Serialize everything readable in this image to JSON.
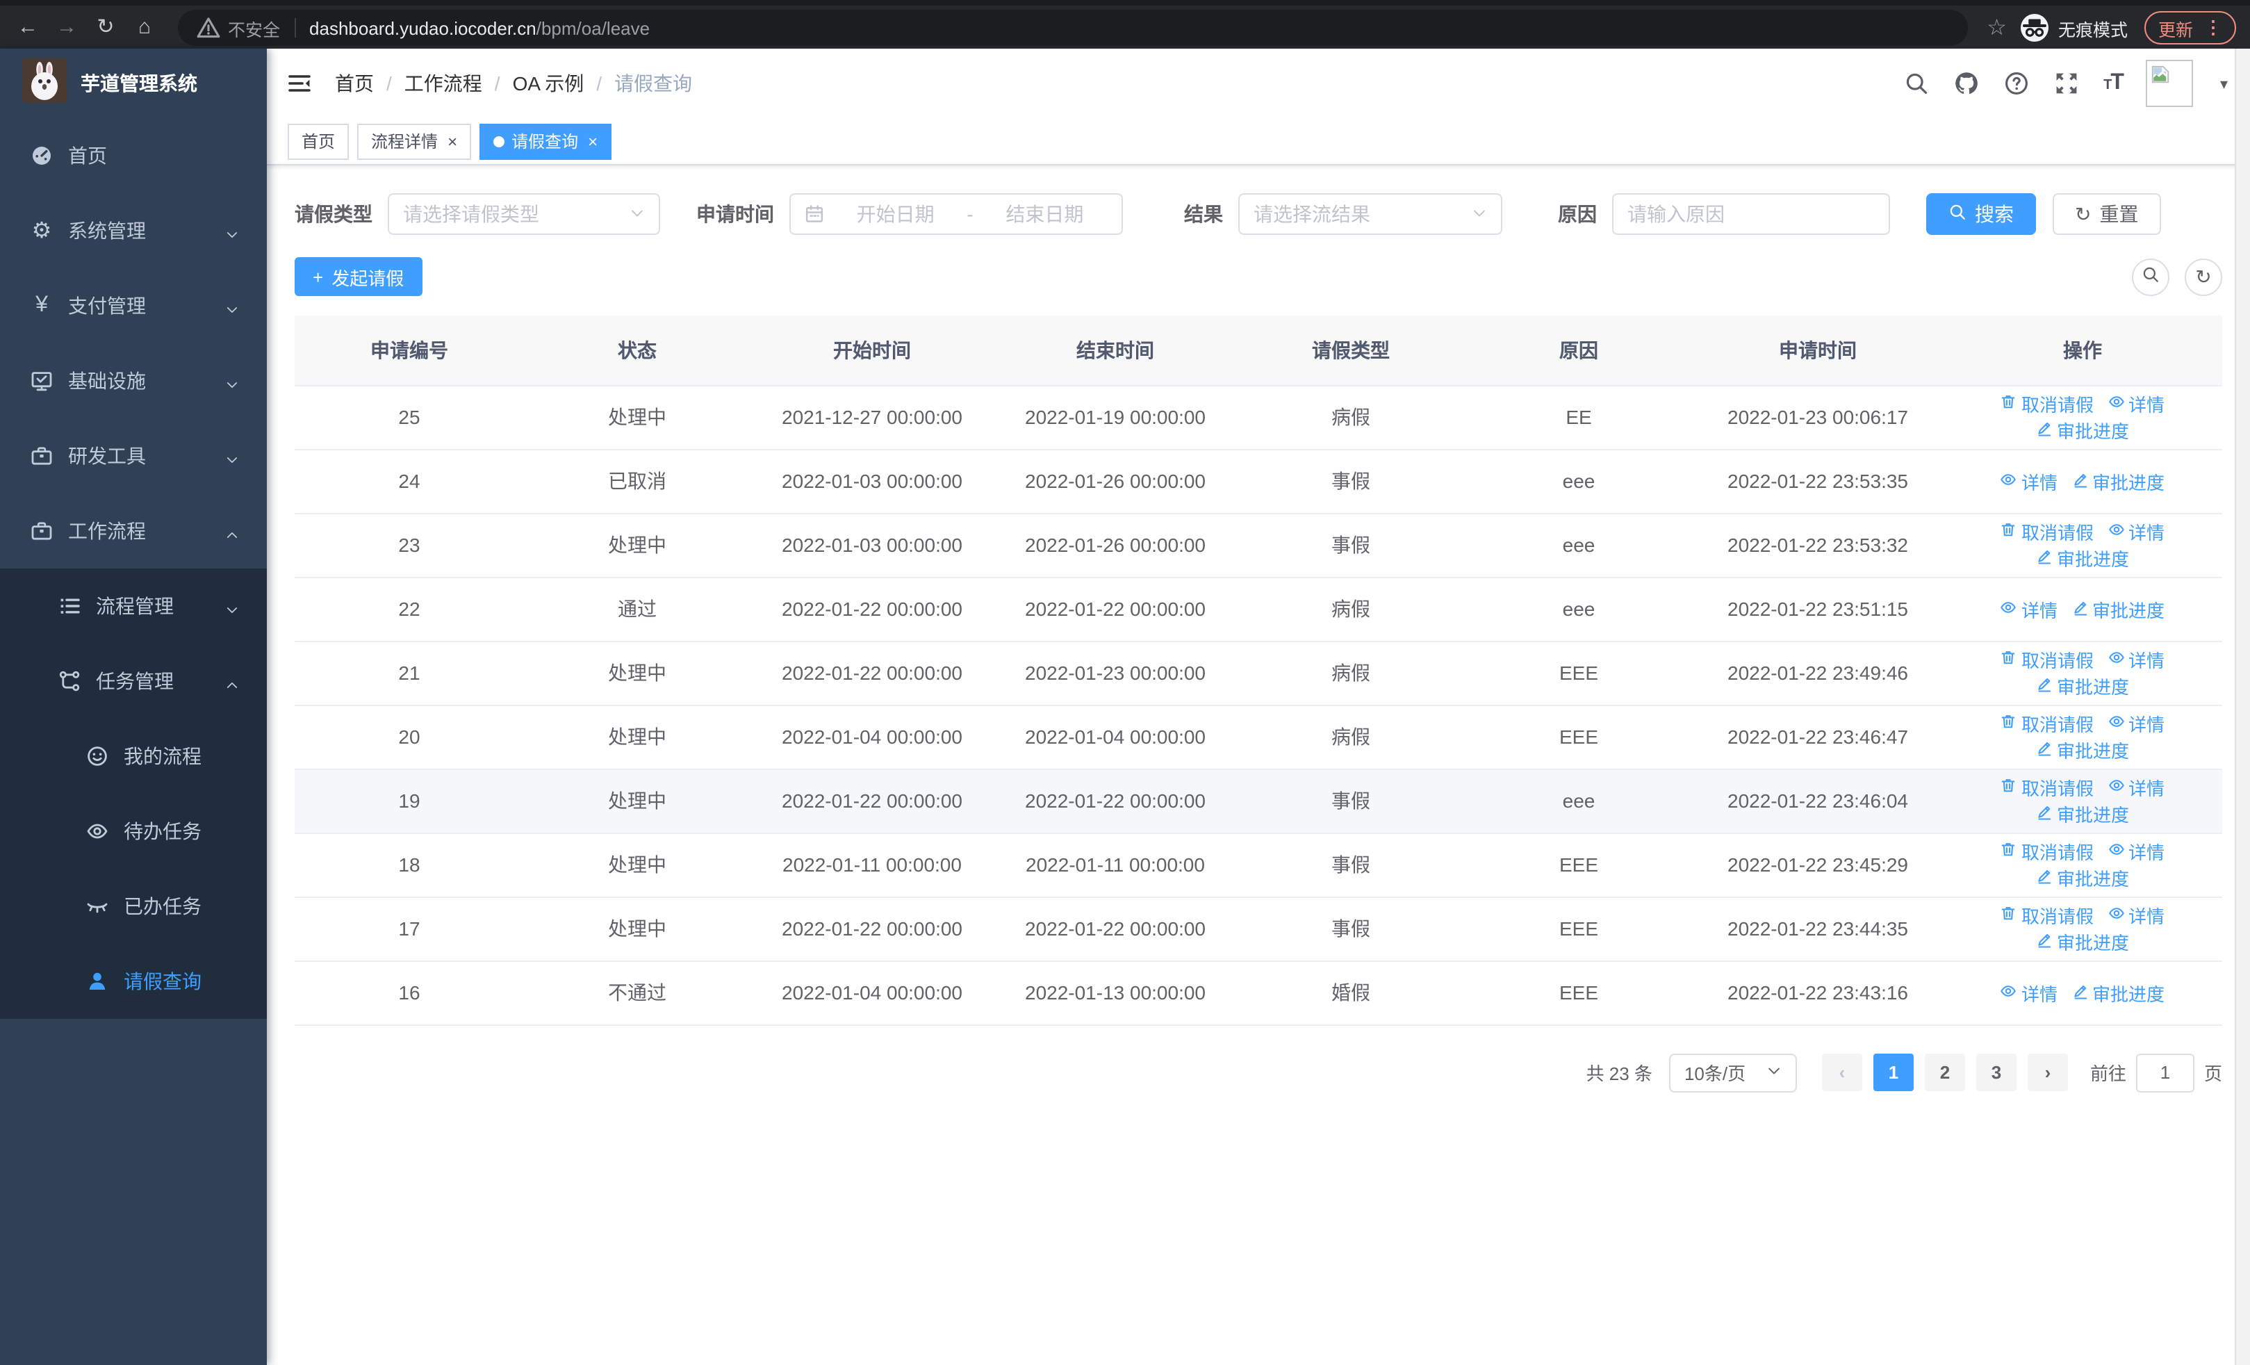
{
  "browser": {
    "security_label": "不安全",
    "url_host": "dashboard.yudao.iocoder.cn",
    "url_path": "/bpm/oa/leave",
    "incognito_label": "无痕模式",
    "update_label": "更新"
  },
  "icon_glyphs": {
    "back-icon": "←",
    "forward-icon": "→",
    "reload-icon": "↻",
    "home-icon": "⌂",
    "star-icon": "☆",
    "more-vert-icon": "⋮",
    "gear-icon": "⚙",
    "yen-icon": "¥",
    "caret-down-icon": "▾",
    "close-icon": "×",
    "plus-icon": "+",
    "prev-icon": "‹",
    "next-icon": "›",
    "refresh-icon": "↻",
    "date-sep": "-"
  },
  "sidebar": {
    "title": "芋道管理系统",
    "items": [
      {
        "label": "首页",
        "icon": "dashboard-icon",
        "level": 1
      },
      {
        "label": "系统管理",
        "icon": "gear-icon",
        "level": 1,
        "chevron": "down"
      },
      {
        "label": "支付管理",
        "icon": "yen-icon",
        "level": 1,
        "chevron": "down"
      },
      {
        "label": "基础设施",
        "icon": "monitor-icon",
        "level": 1,
        "chevron": "down"
      },
      {
        "label": "研发工具",
        "icon": "briefcase-icon",
        "level": 1,
        "chevron": "down"
      },
      {
        "label": "工作流程",
        "icon": "briefcase-icon",
        "level": 1,
        "chevron": "up"
      },
      {
        "label": "流程管理",
        "icon": "list-icon",
        "level": 2,
        "chevron": "down",
        "submenu": true
      },
      {
        "label": "任务管理",
        "icon": "tree-icon",
        "level": 2,
        "chevron": "up",
        "submenu": true
      },
      {
        "label": "我的流程",
        "icon": "face-icon",
        "level": 3,
        "submenu": true
      },
      {
        "label": "待办任务",
        "icon": "eye-icon",
        "level": 3,
        "submenu": true
      },
      {
        "label": "已办任务",
        "icon": "eye-closed-icon",
        "level": 3,
        "submenu": true
      },
      {
        "label": "请假查询",
        "icon": "user-icon",
        "level": 3,
        "submenu": true,
        "active": true
      }
    ]
  },
  "breadcrumb": {
    "items": [
      "首页",
      "工作流程",
      "OA 示例",
      "请假查询"
    ]
  },
  "tabs": [
    {
      "label": "首页"
    },
    {
      "label": "流程详情",
      "closable": true
    },
    {
      "label": "请假查询",
      "closable": true,
      "active": true
    }
  ],
  "filters": {
    "type_label": "请假类型",
    "type_placeholder": "请选择请假类型",
    "time_label": "申请时间",
    "date_start_placeholder": "开始日期",
    "date_end_placeholder": "结束日期",
    "result_label": "结果",
    "result_placeholder": "请选择流结果",
    "reason_label": "原因",
    "reason_placeholder": "请输入原因",
    "search_label": "搜索",
    "reset_label": "重置"
  },
  "toolbar": {
    "create_label": "发起请假"
  },
  "table": {
    "columns": [
      "申请编号",
      "状态",
      "开始时间",
      "结束时间",
      "请假类型",
      "原因",
      "申请时间",
      "操作"
    ],
    "action_labels": {
      "cancel": "取消请假",
      "detail": "详情",
      "progress": "审批进度"
    },
    "rows": [
      {
        "id": "25",
        "status": "处理中",
        "start": "2021-12-27 00:00:00",
        "end": "2022-01-19 00:00:00",
        "type": "病假",
        "reason": "EE",
        "apply_time": "2022-01-23 00:06:17",
        "actions": [
          "cancel",
          "detail",
          "progress"
        ]
      },
      {
        "id": "24",
        "status": "已取消",
        "start": "2022-01-03 00:00:00",
        "end": "2022-01-26 00:00:00",
        "type": "事假",
        "reason": "eee",
        "apply_time": "2022-01-22 23:53:35",
        "actions": [
          "detail",
          "progress"
        ]
      },
      {
        "id": "23",
        "status": "处理中",
        "start": "2022-01-03 00:00:00",
        "end": "2022-01-26 00:00:00",
        "type": "事假",
        "reason": "eee",
        "apply_time": "2022-01-22 23:53:32",
        "actions": [
          "cancel",
          "detail",
          "progress"
        ]
      },
      {
        "id": "22",
        "status": "通过",
        "start": "2022-01-22 00:00:00",
        "end": "2022-01-22 00:00:00",
        "type": "病假",
        "reason": "eee",
        "apply_time": "2022-01-22 23:51:15",
        "actions": [
          "detail",
          "progress"
        ]
      },
      {
        "id": "21",
        "status": "处理中",
        "start": "2022-01-22 00:00:00",
        "end": "2022-01-23 00:00:00",
        "type": "病假",
        "reason": "EEE",
        "apply_time": "2022-01-22 23:49:46",
        "actions": [
          "cancel",
          "detail",
          "progress"
        ]
      },
      {
        "id": "20",
        "status": "处理中",
        "start": "2022-01-04 00:00:00",
        "end": "2022-01-04 00:00:00",
        "type": "病假",
        "reason": "EEE",
        "apply_time": "2022-01-22 23:46:47",
        "actions": [
          "cancel",
          "detail",
          "progress"
        ]
      },
      {
        "id": "19",
        "status": "处理中",
        "start": "2022-01-22 00:00:00",
        "end": "2022-01-22 00:00:00",
        "type": "事假",
        "reason": "eee",
        "apply_time": "2022-01-22 23:46:04",
        "actions": [
          "cancel",
          "detail",
          "progress"
        ],
        "hover": true
      },
      {
        "id": "18",
        "status": "处理中",
        "start": "2022-01-11 00:00:00",
        "end": "2022-01-11 00:00:00",
        "type": "事假",
        "reason": "EEE",
        "apply_time": "2022-01-22 23:45:29",
        "actions": [
          "cancel",
          "detail",
          "progress"
        ]
      },
      {
        "id": "17",
        "status": "处理中",
        "start": "2022-01-22 00:00:00",
        "end": "2022-01-22 00:00:00",
        "type": "事假",
        "reason": "EEE",
        "apply_time": "2022-01-22 23:44:35",
        "actions": [
          "cancel",
          "detail",
          "progress"
        ]
      },
      {
        "id": "16",
        "status": "不通过",
        "start": "2022-01-04 00:00:00",
        "end": "2022-01-13 00:00:00",
        "type": "婚假",
        "reason": "EEE",
        "apply_time": "2022-01-22 23:43:16",
        "actions": [
          "detail",
          "progress"
        ]
      }
    ]
  },
  "pagination": {
    "total_label": "共 23 条",
    "page_size_label": "10条/页",
    "pages": [
      "1",
      "2",
      "3"
    ],
    "current_page": "1",
    "goto_label": "前往",
    "goto_value": "1",
    "page_unit_label": "页"
  },
  "colors": {
    "accent": "#409eff",
    "sidebar_bg": "#304156",
    "submenu_bg": "#1f2d3d",
    "sidebar_text": "#bfcbd9",
    "table_header_bg": "#f8f8f9",
    "table_border": "#ebeef5",
    "breadcrumb_muted": "#97a8be",
    "update_accent": "#f28b82"
  }
}
